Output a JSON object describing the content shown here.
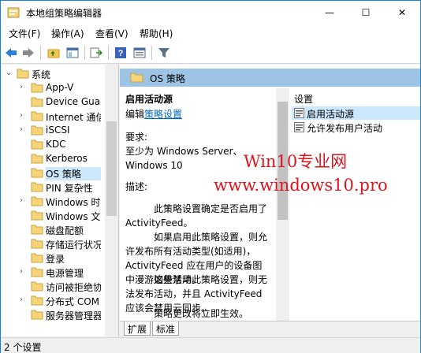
{
  "window": {
    "title": "本地组策略编辑器",
    "min": "—",
    "max": "☐",
    "close": "✕"
  },
  "menu": [
    "文件(F)",
    "操作(A)",
    "查看(V)",
    "帮助(H)"
  ],
  "tree": [
    {
      "label": "系统",
      "indent": 0,
      "exp": "⌄"
    },
    {
      "label": "App-V",
      "indent": 1,
      "exp": "›"
    },
    {
      "label": "Device Guard",
      "indent": 1,
      "exp": ""
    },
    {
      "label": "Internet 通信管理",
      "indent": 1,
      "exp": "›"
    },
    {
      "label": "iSCSI",
      "indent": 1,
      "exp": "›"
    },
    {
      "label": "KDC",
      "indent": 1,
      "exp": ""
    },
    {
      "label": "Kerberos",
      "indent": 1,
      "exp": ""
    },
    {
      "label": "OS 策略",
      "indent": 1,
      "exp": "",
      "selected": true
    },
    {
      "label": "PIN 复杂性",
      "indent": 1,
      "exp": ""
    },
    {
      "label": "Windows 时间服务",
      "indent": 1,
      "exp": "›"
    },
    {
      "label": "Windows 文件保护",
      "indent": 1,
      "exp": ""
    },
    {
      "label": "磁盘配额",
      "indent": 1,
      "exp": ""
    },
    {
      "label": "存储运行状况",
      "indent": 1,
      "exp": ""
    },
    {
      "label": "登录",
      "indent": 1,
      "exp": ""
    },
    {
      "label": "电源管理",
      "indent": 1,
      "exp": "›"
    },
    {
      "label": "访问被拒绝协助",
      "indent": 1,
      "exp": ""
    },
    {
      "label": "分布式 COM",
      "indent": 1,
      "exp": "›"
    },
    {
      "label": "服务器管理器",
      "indent": 1,
      "exp": ""
    }
  ],
  "header": {
    "title": "OS 策略"
  },
  "desc": {
    "title": "启用活动源",
    "edit_prefix": "编辑",
    "edit_link": "策略设置",
    "req_label": "要求:",
    "req_text": "至少为 Windows Server、Windows 10",
    "desc_label": "描述:",
    "p1": "此策略设置确定是否启用了 ActivityFeed。",
    "p2": "如果启用此策略设置，则允许发布所有活动类型(如适用)，ActivityFeed 应在用户的设备图中漫游这些活动。",
    "p3": "如果禁用此策略设置，则无法发布活动，并且 ActivityFeed 应该会禁用云同步。",
    "p4": "策略更改将立即生效。"
  },
  "list": {
    "header": "设置",
    "rows": [
      "启用活动源",
      "允许发布用户活动"
    ]
  },
  "tabs": [
    "扩展",
    "标准"
  ],
  "status": "2 个设置",
  "watermark": {
    "line1": "Win10专业网",
    "line2": "www.windows10.pro"
  }
}
